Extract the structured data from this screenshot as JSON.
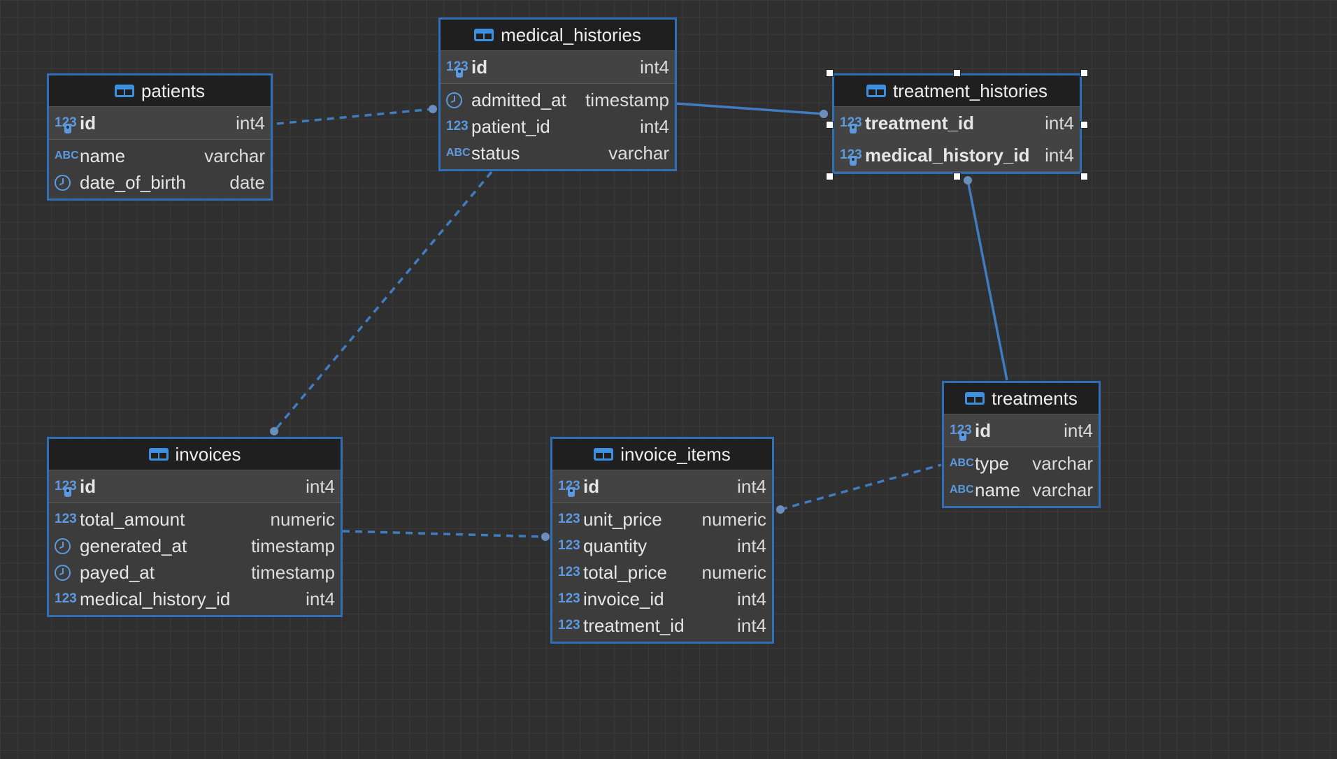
{
  "tables": {
    "patients": {
      "name": "patients",
      "pk": [
        {
          "name": "id",
          "type": "int4"
        }
      ],
      "columns": [
        {
          "icon": "ABC",
          "name": "name",
          "type": "varchar"
        },
        {
          "icon": "clock",
          "name": "date_of_birth",
          "type": "date"
        }
      ]
    },
    "medical_histories": {
      "name": "medical_histories",
      "pk": [
        {
          "name": "id",
          "type": "int4"
        }
      ],
      "columns": [
        {
          "icon": "clock",
          "name": "admitted_at",
          "type": "timestamp"
        },
        {
          "icon": "123",
          "name": "patient_id",
          "type": "int4"
        },
        {
          "icon": "ABC",
          "name": "status",
          "type": "varchar"
        }
      ]
    },
    "treatment_histories": {
      "name": "treatment_histories",
      "pk": [
        {
          "name": "treatment_id",
          "type": "int4"
        },
        {
          "name": "medical_history_id",
          "type": "int4"
        }
      ],
      "columns": []
    },
    "treatments": {
      "name": "treatments",
      "pk": [
        {
          "name": "id",
          "type": "int4"
        }
      ],
      "columns": [
        {
          "icon": "ABC",
          "name": "type",
          "type": "varchar"
        },
        {
          "icon": "ABC",
          "name": "name",
          "type": "varchar"
        }
      ]
    },
    "invoices": {
      "name": "invoices",
      "pk": [
        {
          "name": "id",
          "type": "int4"
        }
      ],
      "columns": [
        {
          "icon": "123",
          "name": "total_amount",
          "type": "numeric"
        },
        {
          "icon": "clock",
          "name": "generated_at",
          "type": "timestamp"
        },
        {
          "icon": "clock",
          "name": "payed_at",
          "type": "timestamp"
        },
        {
          "icon": "123",
          "name": "medical_history_id",
          "type": "int4"
        }
      ]
    },
    "invoice_items": {
      "name": "invoice_items",
      "pk": [
        {
          "name": "id",
          "type": "int4"
        }
      ],
      "columns": [
        {
          "icon": "123",
          "name": "unit_price",
          "type": "numeric"
        },
        {
          "icon": "123",
          "name": "quantity",
          "type": "int4"
        },
        {
          "icon": "123",
          "name": "total_price",
          "type": "numeric"
        },
        {
          "icon": "123",
          "name": "invoice_id",
          "type": "int4"
        },
        {
          "icon": "123",
          "name": "treatment_id",
          "type": "int4"
        }
      ]
    }
  },
  "icons": {
    "table": "table-icon",
    "key": "primary-key-icon",
    "clock": "clock-icon",
    "number": "123",
    "text": "ABC"
  },
  "colors": {
    "accent": "#2e6fb8",
    "background": "#2f2f2f",
    "header": "#1f1f1f"
  }
}
